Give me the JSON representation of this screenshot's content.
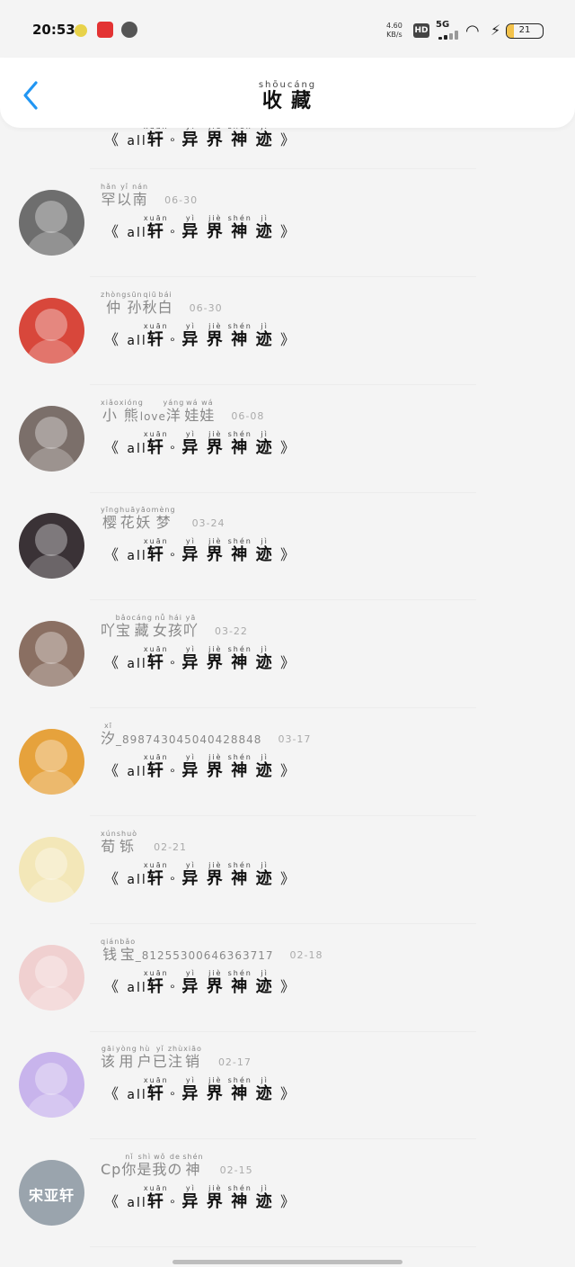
{
  "status_bar": {
    "time": "20:53",
    "net_speed": "4.60",
    "net_unit": "KB/s",
    "hd": "HD",
    "network": "5G",
    "battery": "21"
  },
  "header": {
    "title_chars": [
      {
        "c": "收",
        "p": "shōu"
      },
      {
        "c": "藏",
        "p": "cáng"
      }
    ]
  },
  "book": {
    "open": "《",
    "all": "all",
    "xuan": {
      "c": "轩",
      "p": "xuān"
    },
    "sep": "ᵒ",
    "chars": [
      {
        "c": "异",
        "p": "yì"
      },
      {
        "c": "界",
        "p": "jiè"
      },
      {
        "c": "神",
        "p": "shén"
      },
      {
        "c": "迹",
        "p": "jì"
      }
    ],
    "close": "》"
  },
  "items": [
    {
      "name": [
        {
          "c": "罕",
          "p": "hǎn"
        },
        {
          "c": "以",
          "p": "yǐ"
        },
        {
          "c": "南",
          "p": "nán"
        }
      ],
      "date": "06-30",
      "avatar_color": "#6e6e6e"
    },
    {
      "name": [
        {
          "c": "仲",
          "p": "zhòng"
        },
        {
          "c": "孙",
          "p": "sūn"
        },
        {
          "c": "秋",
          "p": "qiū"
        },
        {
          "c": "白",
          "p": "bái"
        }
      ],
      "date": "06-30",
      "avatar_color": "#d8473b"
    },
    {
      "name": [
        {
          "c": "小",
          "p": "xiǎo"
        },
        {
          "c": "熊",
          "p": "xióng"
        },
        {
          "c": "love",
          "p": ""
        },
        {
          "c": "洋",
          "p": "yáng"
        },
        {
          "c": "娃",
          "p": "wá"
        },
        {
          "c": "娃",
          "p": "wá"
        }
      ],
      "date": "06-08",
      "avatar_color": "#7b6f6a"
    },
    {
      "name": [
        {
          "c": "樱",
          "p": "yīng"
        },
        {
          "c": "花",
          "p": "huā"
        },
        {
          "c": "妖",
          "p": "yāo"
        },
        {
          "c": "梦",
          "p": "mèng"
        }
      ],
      "date": "03-24",
      "avatar_color": "#3a3236"
    },
    {
      "name": [
        {
          "c": "吖",
          "p": ""
        },
        {
          "c": "宝",
          "p": "bǎo"
        },
        {
          "c": "藏",
          "p": "cáng"
        },
        {
          "c": "女",
          "p": "nǚ"
        },
        {
          "c": "孩",
          "p": "hái"
        },
        {
          "c": "吖",
          "p": "yā"
        }
      ],
      "date": "03-22",
      "avatar_color": "#8a6f62"
    },
    {
      "name": [
        {
          "c": "汐",
          "p": "xī"
        },
        {
          "c": "_898743045040428848",
          "p": ""
        }
      ],
      "date": "03-17",
      "avatar_color": "#e6a23c"
    },
    {
      "name": [
        {
          "c": "荀",
          "p": "xún"
        },
        {
          "c": "铄",
          "p": "shuò"
        }
      ],
      "date": "02-21",
      "avatar_color": "#f3e7b8"
    },
    {
      "name": [
        {
          "c": "钱",
          "p": "qián"
        },
        {
          "c": "宝",
          "p": "bǎo"
        },
        {
          "c": "_81255300646363717",
          "p": ""
        }
      ],
      "date": "02-18",
      "avatar_color": "#f0d0d0"
    },
    {
      "name": [
        {
          "c": "该",
          "p": "gāi"
        },
        {
          "c": "用",
          "p": "yòng"
        },
        {
          "c": "户",
          "p": "hù"
        },
        {
          "c": "已",
          "p": "yǐ"
        },
        {
          "c": "注",
          "p": "zhù"
        },
        {
          "c": "销",
          "p": "xiāo"
        }
      ],
      "date": "02-17",
      "avatar_color": "#c8b4ec"
    },
    {
      "name": [
        {
          "c": "Cp",
          "p": ""
        },
        {
          "c": "你",
          "p": "nǐ"
        },
        {
          "c": "是",
          "p": "shì"
        },
        {
          "c": "我",
          "p": "wǒ"
        },
        {
          "c": "の",
          "p": "de"
        },
        {
          "c": "神",
          "p": "shén"
        }
      ],
      "date": "02-15",
      "avatar_color": "#9aa4ad",
      "avatar_text": "宋亚轩"
    }
  ]
}
